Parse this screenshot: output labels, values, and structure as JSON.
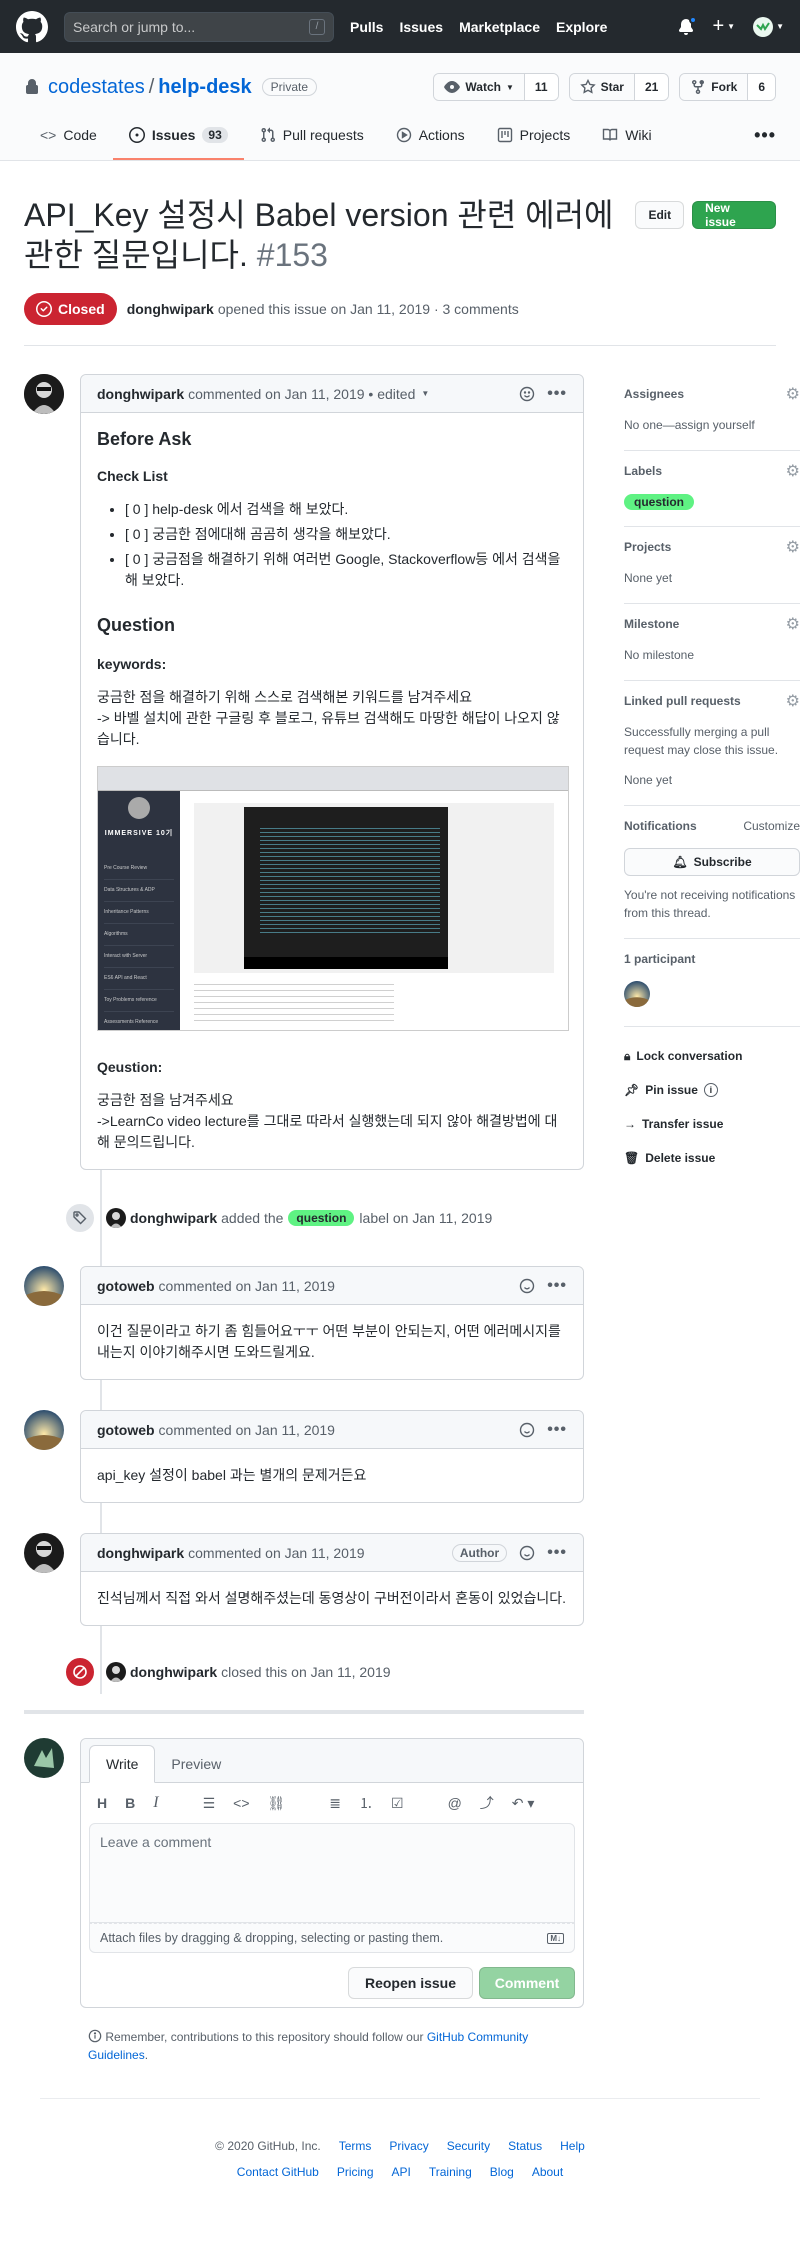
{
  "header": {
    "search_placeholder": "Search or jump to...",
    "search_key": "/",
    "nav": [
      "Pulls",
      "Issues",
      "Marketplace",
      "Explore"
    ],
    "new_symbol": "+"
  },
  "repo": {
    "owner": "codestates",
    "separator": "/",
    "name": "help-desk",
    "visibility": "Private",
    "watch_label": "Watch",
    "watch_count": "11",
    "star_label": "Star",
    "star_count": "21",
    "fork_label": "Fork",
    "fork_count": "6",
    "tabs": [
      {
        "label": "Code"
      },
      {
        "label": "Issues",
        "count": "93"
      },
      {
        "label": "Pull requests"
      },
      {
        "label": "Actions"
      },
      {
        "label": "Projects"
      },
      {
        "label": "Wiki"
      }
    ],
    "more": "•••"
  },
  "issue": {
    "title": "API_Key 설정시 Babel version 관련 에러에 관한 질문입니다.",
    "number": "#153",
    "edit_label": "Edit",
    "new_issue_label": "New issue",
    "state": "Closed",
    "author": "donghwipark",
    "meta": "opened this issue on Jan 11, 2019 · 3 comments"
  },
  "first_comment": {
    "author": "donghwipark",
    "meta": "commented on Jan 11, 2019 • edited",
    "h_before": "Before Ask",
    "h_checklist": "Check List",
    "checklist": [
      "[ 0 ] help-desk 에서 검색을 해 보았다.",
      "[ 0 ] 궁금한 점에대해 곰곰히 생각을 해보았다.",
      "[ 0 ] 궁금점을 해결하기 위해 여러번 Google, Stackoverflow등 에서 검색을 해 보았다."
    ],
    "h_question": "Question",
    "h_keywords": "keywords:",
    "keywords_line1": "궁금한 점을 해결하기 위해 스스로 검색해본 키워드를 남겨주세요",
    "keywords_line2": "-> 바벨 설치에 관한 구글링 후 블로그, 유튜브 검색해도 마땅한 해답이 나오지 않습니다.",
    "h_qeustion": "Qeustion:",
    "question_line1": "궁금한 점을 남겨주세요",
    "question_line2": "->LearnCo video lecture를 그대로 따라서 실행했는데 되지 않아 해결방법에 대해 문의드립니다.",
    "screenshot_brand": "IMMERSIVE 10기",
    "screenshot_menu": [
      "Pre Course Review",
      "Data Structures & ADP",
      "Inheritance Patterns",
      "Algorithms",
      "Interact with Server",
      "ES6 API and React",
      "Toy Problems reference",
      "Assessments Reference"
    ]
  },
  "label_event": {
    "author": "donghwipark",
    "text_before": "added the",
    "label": "question",
    "text_after": "label on Jan 11, 2019"
  },
  "comments": [
    {
      "author": "gotoweb",
      "meta": "commented on Jan 11, 2019",
      "body": "이건 질문이라고 하기 좀 힘들어요ㅜㅜ 어떤 부분이 안되는지, 어떤 에러메시지를 내는지 이야기해주시면 도와드릴게요."
    },
    {
      "author": "gotoweb",
      "meta": "commented on Jan 11, 2019",
      "body": "api_key 설정이 babel 과는 별개의 문제거든요"
    },
    {
      "author": "donghwipark",
      "meta": "commented on Jan 11, 2019",
      "badge": "Author",
      "body": "진석님께서 직접 와서 설명해주셨는데 동영상이 구버전이라서 혼동이 있었습니다."
    }
  ],
  "close_event": {
    "author": "donghwipark",
    "text": "closed this on Jan 11, 2019"
  },
  "editor": {
    "tab_write": "Write",
    "tab_preview": "Preview",
    "placeholder": "Leave a comment",
    "attach": "Attach files by dragging & dropping, selecting or pasting them.",
    "reopen_label": "Reopen issue",
    "comment_label": "Comment",
    "remember_prefix": "Remember, contributions to this repository should follow our",
    "remember_link": "GitHub Community Guidelines",
    "remember_suffix": "."
  },
  "sidebar": {
    "assignees_title": "Assignees",
    "assignees_value": "No one—assign yourself",
    "labels_title": "Labels",
    "labels_value": "question",
    "projects_title": "Projects",
    "projects_value": "None yet",
    "milestone_title": "Milestone",
    "milestone_value": "No milestone",
    "linked_title": "Linked pull requests",
    "linked_text": "Successfully merging a pull request may close this issue.",
    "linked_value": "None yet",
    "notifications_title": "Notifications",
    "customize": "Customize",
    "subscribe_label": "Subscribe",
    "notifications_text": "You're not receiving notifications from this thread.",
    "participants": "1 participant",
    "lock": "Lock conversation",
    "pin": "Pin issue",
    "transfer": "Transfer issue",
    "delete": "Delete issue"
  },
  "footer": {
    "copyright": "© 2020 GitHub, Inc.",
    "row1": [
      "Terms",
      "Privacy",
      "Security",
      "Status",
      "Help"
    ],
    "row2": [
      "Contact GitHub",
      "Pricing",
      "API",
      "Training",
      "Blog",
      "About"
    ]
  },
  "colors": {
    "header_bg": "#24292e",
    "closed_red": "#cb2431",
    "primary_green": "#2ea44f",
    "label_green": "#5ff283",
    "link_blue": "#0366d6"
  }
}
